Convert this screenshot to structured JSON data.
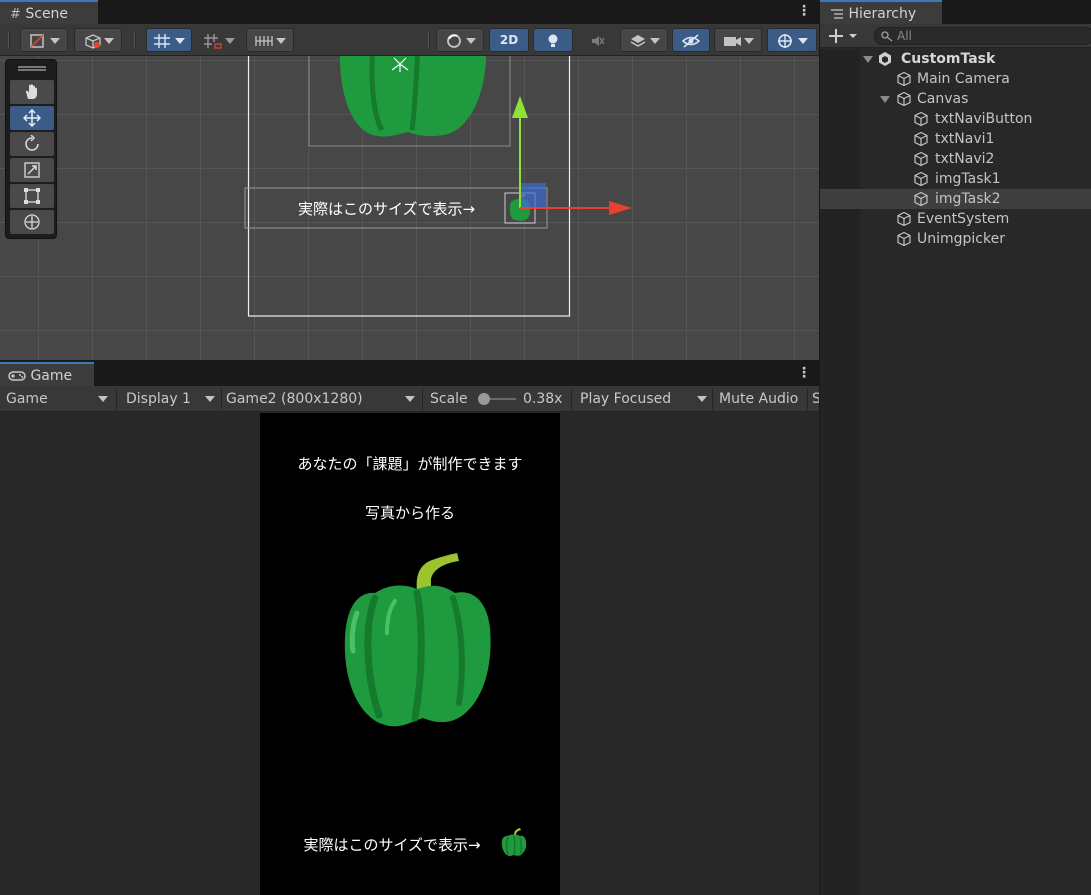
{
  "scene": {
    "tab_label": "Scene",
    "toolbar": {
      "mode_2d_label": "2D"
    },
    "canvas_caption": "実際はこのサイズで表示→"
  },
  "hierarchy": {
    "tab_label": "Hierarchy",
    "search_placeholder": "All",
    "items": [
      {
        "label": "CustomTask",
        "icon": "unity-scene-icon",
        "expanded": true
      },
      {
        "label": "Main Camera",
        "icon": "gameobject-cube-icon"
      },
      {
        "label": "Canvas",
        "icon": "gameobject-cube-icon",
        "expanded": true
      },
      {
        "label": "txtNaviButton",
        "icon": "gameobject-cube-icon"
      },
      {
        "label": "txtNavi1",
        "icon": "gameobject-cube-icon"
      },
      {
        "label": "txtNavi2",
        "icon": "gameobject-cube-icon"
      },
      {
        "label": "imgTask1",
        "icon": "gameobject-cube-icon"
      },
      {
        "label": "imgTask2",
        "icon": "gameobject-cube-icon",
        "selected": true
      },
      {
        "label": "EventSystem",
        "icon": "gameobject-cube-icon"
      },
      {
        "label": "Unimgpicker",
        "icon": "gameobject-cube-icon"
      }
    ]
  },
  "game": {
    "tab_label": "Game",
    "toolbar": {
      "view_select": "Game",
      "display_select": "Display 1",
      "resolution_select": "Game2 (800x1280)",
      "scale_label": "Scale",
      "scale_value": "0.38x",
      "play_mode": "Play Focused",
      "mute_audio": "Mute Audio",
      "overflow_text": "S"
    },
    "screen": {
      "line1": "あなたの「課題」が制作できます",
      "line2": "写真から作る",
      "caption": "実際はこのサイズで表示→"
    }
  },
  "colors": {
    "pepper_green": "#1f9a3e",
    "pepper_dark": "#157a2c",
    "stem": "#9cc42e",
    "selection_blue": "#3b5c87",
    "gizmo_x": "#e8412e",
    "gizmo_y": "#8fe233"
  }
}
